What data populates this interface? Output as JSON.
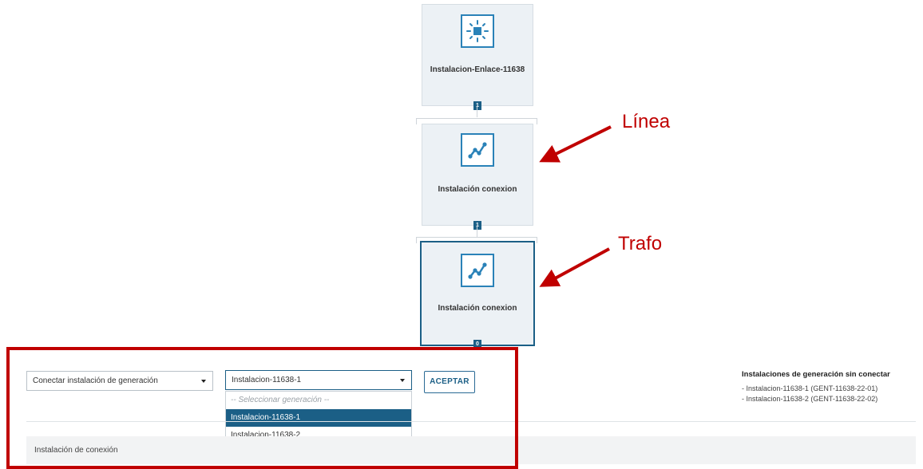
{
  "nodes": [
    {
      "label": "Instalacion-Enlace-11638",
      "icon": "sun-icon",
      "badge": "1"
    },
    {
      "label": "Instalación conexion",
      "icon": "line-chart-icon",
      "badge": "1"
    },
    {
      "label": "Instalación conexion",
      "icon": "line-chart-icon",
      "badge": "0",
      "selected": true
    }
  ],
  "annotations": {
    "linea": "Línea",
    "trafo": "Trafo"
  },
  "form": {
    "action_select_value": "Conectar instalación de generación",
    "generation_select_value": "Instalacion-11638-1",
    "accept_label": "ACEPTAR",
    "dropdown_options": [
      {
        "label": "-- Seleccionar generación --",
        "placeholder": true
      },
      {
        "label": "Instalacion-11638-1",
        "selected": true
      },
      {
        "label": "Instalacion-11638-2"
      }
    ]
  },
  "unconnected": {
    "title": "Instalaciones de generación sin conectar",
    "items": [
      "- Instalacion-11638-1 (GENT-11638-22-01)",
      "- Instalacion-11638-2 (GENT-11638-22-02)"
    ]
  },
  "section": {
    "label": "Instalación de conexión"
  },
  "colors": {
    "accent": "#1b5f86",
    "annotation": "#c00000",
    "node_bg": "#ecf1f5"
  }
}
